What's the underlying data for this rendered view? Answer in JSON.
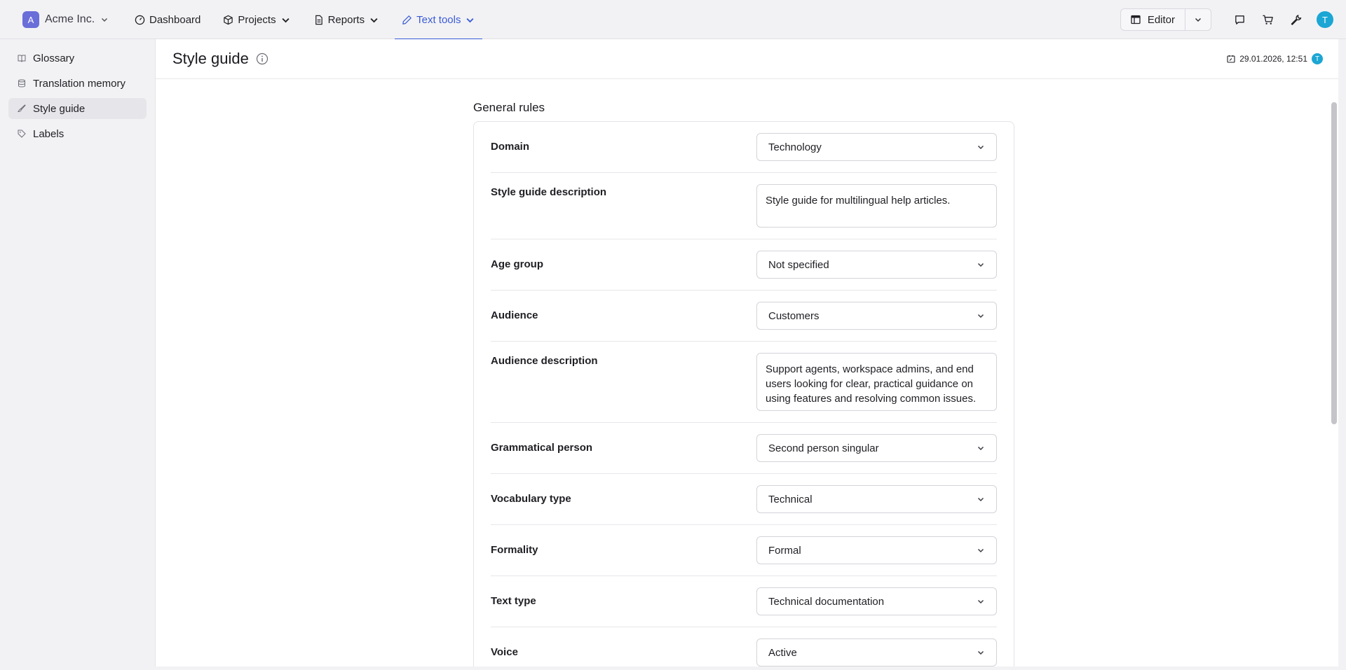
{
  "workspace": {
    "initial": "A",
    "name": "Acme Inc."
  },
  "nav": {
    "dashboard": "Dashboard",
    "projects": "Projects",
    "reports": "Reports",
    "text_tools": "Text tools"
  },
  "toolbar": {
    "editor_label": "Editor",
    "user_initial": "T"
  },
  "sidebar": {
    "items": [
      {
        "label": "Glossary"
      },
      {
        "label": "Translation memory"
      },
      {
        "label": "Style guide"
      },
      {
        "label": "Labels"
      }
    ]
  },
  "page": {
    "title": "Style guide",
    "modified": "29.01.2026, 12:51",
    "modified_by_initial": "T"
  },
  "general_rules": {
    "title": "General rules",
    "rows": [
      {
        "label": "Domain",
        "value": "Technology"
      },
      {
        "label": "Style guide description",
        "value": "Style guide for multilingual help articles."
      },
      {
        "label": "Age group",
        "value": "Not specified"
      },
      {
        "label": "Audience",
        "value": "Customers"
      },
      {
        "label": "Audience description",
        "value": "Support agents, workspace admins, and end users looking for clear, practical guidance on using features and resolving common issues."
      },
      {
        "label": "Grammatical person",
        "value": "Second person singular"
      },
      {
        "label": "Vocabulary type",
        "value": "Technical"
      },
      {
        "label": "Formality",
        "value": "Formal"
      },
      {
        "label": "Text type",
        "value": "Technical documentation"
      },
      {
        "label": "Voice",
        "value": "Active"
      }
    ]
  }
}
